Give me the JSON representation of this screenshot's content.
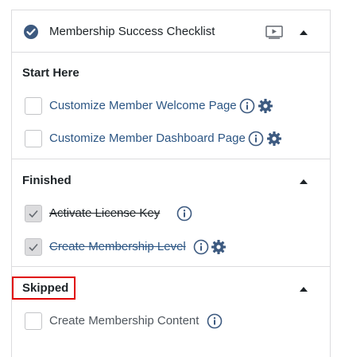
{
  "header": {
    "title": "Membership Success Checklist",
    "icons": [
      "check-circle-icon",
      "video-icon",
      "caret-up-icon"
    ]
  },
  "sections": [
    {
      "title": "Start Here",
      "items": [
        {
          "label": "Customize Member Welcome Page",
          "checked": false,
          "icons": [
            "info-icon",
            "gear-icon"
          ]
        },
        {
          "label": "Customize Member Dashboard Page",
          "checked": false,
          "icons": [
            "info-icon",
            "gear-icon"
          ]
        }
      ]
    },
    {
      "title": "Finished",
      "items": [
        {
          "label": "Activate License Key",
          "checked": true,
          "icons": [
            "info-icon"
          ]
        },
        {
          "label": "Create Membership Level",
          "checked": true,
          "icons": [
            "info-icon",
            "gear-icon"
          ]
        }
      ]
    },
    {
      "title": "Skipped",
      "highlighted": true,
      "items": [
        {
          "label": "Create Membership Content",
          "checked": false,
          "icons": [
            "info-icon"
          ]
        }
      ]
    }
  ],
  "colors": {
    "link": "#2c5684",
    "accent": "#3d5a80",
    "highlight_border": "#e00000",
    "divider": "#dcdcde"
  }
}
